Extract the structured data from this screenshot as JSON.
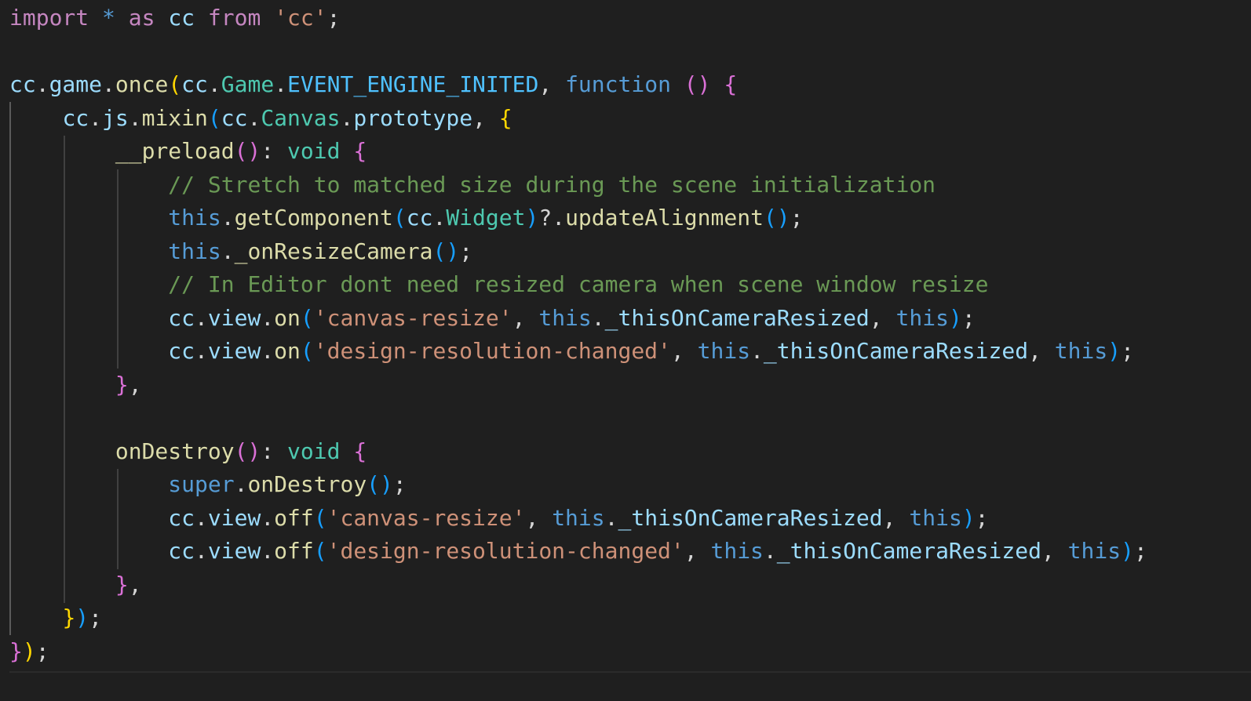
{
  "colors": {
    "background": "#1f1f1f",
    "keyword_control": "#c586c0",
    "keyword": "#569cd6",
    "variable": "#9cdcfe",
    "function": "#dcdcaa",
    "type": "#4ec9b0",
    "constant": "#4fc1ff",
    "string": "#ce9178",
    "comment": "#6a9955",
    "bracket_1": "#ffd700",
    "bracket_2": "#da70d6",
    "bracket_3": "#179fff"
  },
  "lines": [
    [
      [
        "kw-purple",
        "import"
      ],
      [
        "pun",
        " "
      ],
      [
        "kw-blue",
        "*"
      ],
      [
        "pun",
        " "
      ],
      [
        "kw-purple",
        "as"
      ],
      [
        "pun",
        " "
      ],
      [
        "var",
        "cc"
      ],
      [
        "pun",
        " "
      ],
      [
        "kw-purple",
        "from"
      ],
      [
        "pun",
        " "
      ],
      [
        "str",
        "'cc'"
      ],
      [
        "pun",
        ";"
      ]
    ],
    [],
    [
      [
        "var",
        "cc"
      ],
      [
        "pun",
        "."
      ],
      [
        "var",
        "game"
      ],
      [
        "pun",
        "."
      ],
      [
        "fn",
        "once"
      ],
      [
        "b1",
        "("
      ],
      [
        "var",
        "cc"
      ],
      [
        "pun",
        "."
      ],
      [
        "cls",
        "Game"
      ],
      [
        "pun",
        "."
      ],
      [
        "cst",
        "EVENT_ENGINE_INITED"
      ],
      [
        "pun",
        ", "
      ],
      [
        "kw-blue",
        "function"
      ],
      [
        "pun",
        " "
      ],
      [
        "b2",
        "()"
      ],
      [
        "pun",
        " "
      ],
      [
        "b2",
        "{"
      ]
    ],
    [
      [
        "pun",
        "    "
      ],
      [
        "var",
        "cc"
      ],
      [
        "pun",
        "."
      ],
      [
        "var",
        "js"
      ],
      [
        "pun",
        "."
      ],
      [
        "fn",
        "mixin"
      ],
      [
        "b3",
        "("
      ],
      [
        "var",
        "cc"
      ],
      [
        "pun",
        "."
      ],
      [
        "cls",
        "Canvas"
      ],
      [
        "pun",
        "."
      ],
      [
        "var",
        "prototype"
      ],
      [
        "pun",
        ", "
      ],
      [
        "b1",
        "{"
      ]
    ],
    [
      [
        "pun",
        "        "
      ],
      [
        "fn",
        "__preload"
      ],
      [
        "b2",
        "()"
      ],
      [
        "pun",
        ": "
      ],
      [
        "cls",
        "void"
      ],
      [
        "pun",
        " "
      ],
      [
        "b2",
        "{"
      ]
    ],
    [
      [
        "pun",
        "            "
      ],
      [
        "cmt",
        "// Stretch to matched size during the scene initialization"
      ]
    ],
    [
      [
        "pun",
        "            "
      ],
      [
        "kw-blue",
        "this"
      ],
      [
        "pun",
        "."
      ],
      [
        "fn",
        "getComponent"
      ],
      [
        "b3",
        "("
      ],
      [
        "var",
        "cc"
      ],
      [
        "pun",
        "."
      ],
      [
        "cls",
        "Widget"
      ],
      [
        "b3",
        ")"
      ],
      [
        "pun",
        "?."
      ],
      [
        "fn",
        "updateAlignment"
      ],
      [
        "b3",
        "()"
      ],
      [
        "pun",
        ";"
      ]
    ],
    [
      [
        "pun",
        "            "
      ],
      [
        "kw-blue",
        "this"
      ],
      [
        "pun",
        "."
      ],
      [
        "fn",
        "_onResizeCamera"
      ],
      [
        "b3",
        "()"
      ],
      [
        "pun",
        ";"
      ]
    ],
    [
      [
        "pun",
        "            "
      ],
      [
        "cmt",
        "// In Editor dont need resized camera when scene window resize"
      ]
    ],
    [
      [
        "pun",
        "            "
      ],
      [
        "var",
        "cc"
      ],
      [
        "pun",
        "."
      ],
      [
        "var",
        "view"
      ],
      [
        "pun",
        "."
      ],
      [
        "fn",
        "on"
      ],
      [
        "b3",
        "("
      ],
      [
        "str",
        "'canvas-resize'"
      ],
      [
        "pun",
        ", "
      ],
      [
        "kw-blue",
        "this"
      ],
      [
        "pun",
        "."
      ],
      [
        "var",
        "_thisOnCameraResized"
      ],
      [
        "pun",
        ", "
      ],
      [
        "kw-blue",
        "this"
      ],
      [
        "b3",
        ")"
      ],
      [
        "pun",
        ";"
      ]
    ],
    [
      [
        "pun",
        "            "
      ],
      [
        "var",
        "cc"
      ],
      [
        "pun",
        "."
      ],
      [
        "var",
        "view"
      ],
      [
        "pun",
        "."
      ],
      [
        "fn",
        "on"
      ],
      [
        "b3",
        "("
      ],
      [
        "str",
        "'design-resolution-changed'"
      ],
      [
        "pun",
        ", "
      ],
      [
        "kw-blue",
        "this"
      ],
      [
        "pun",
        "."
      ],
      [
        "var",
        "_thisOnCameraResized"
      ],
      [
        "pun",
        ", "
      ],
      [
        "kw-blue",
        "this"
      ],
      [
        "b3",
        ")"
      ],
      [
        "pun",
        ";"
      ]
    ],
    [
      [
        "pun",
        "        "
      ],
      [
        "b2",
        "}"
      ],
      [
        "pun",
        ","
      ]
    ],
    [],
    [
      [
        "pun",
        "        "
      ],
      [
        "fn",
        "onDestroy"
      ],
      [
        "b2",
        "()"
      ],
      [
        "pun",
        ": "
      ],
      [
        "cls",
        "void"
      ],
      [
        "pun",
        " "
      ],
      [
        "b2",
        "{"
      ]
    ],
    [
      [
        "pun",
        "            "
      ],
      [
        "kw-blue",
        "super"
      ],
      [
        "pun",
        "."
      ],
      [
        "fn",
        "onDestroy"
      ],
      [
        "b3",
        "()"
      ],
      [
        "pun",
        ";"
      ]
    ],
    [
      [
        "pun",
        "            "
      ],
      [
        "var",
        "cc"
      ],
      [
        "pun",
        "."
      ],
      [
        "var",
        "view"
      ],
      [
        "pun",
        "."
      ],
      [
        "fn",
        "off"
      ],
      [
        "b3",
        "("
      ],
      [
        "str",
        "'canvas-resize'"
      ],
      [
        "pun",
        ", "
      ],
      [
        "kw-blue",
        "this"
      ],
      [
        "pun",
        "."
      ],
      [
        "var",
        "_thisOnCameraResized"
      ],
      [
        "pun",
        ", "
      ],
      [
        "kw-blue",
        "this"
      ],
      [
        "b3",
        ")"
      ],
      [
        "pun",
        ";"
      ]
    ],
    [
      [
        "pun",
        "            "
      ],
      [
        "var",
        "cc"
      ],
      [
        "pun",
        "."
      ],
      [
        "var",
        "view"
      ],
      [
        "pun",
        "."
      ],
      [
        "fn",
        "off"
      ],
      [
        "b3",
        "("
      ],
      [
        "str",
        "'design-resolution-changed'"
      ],
      [
        "pun",
        ", "
      ],
      [
        "kw-blue",
        "this"
      ],
      [
        "pun",
        "."
      ],
      [
        "var",
        "_thisOnCameraResized"
      ],
      [
        "pun",
        ", "
      ],
      [
        "kw-blue",
        "this"
      ],
      [
        "b3",
        ")"
      ],
      [
        "pun",
        ";"
      ]
    ],
    [
      [
        "pun",
        "        "
      ],
      [
        "b2",
        "}"
      ],
      [
        "pun",
        ","
      ]
    ],
    [
      [
        "pun",
        "    "
      ],
      [
        "b1",
        "}"
      ],
      [
        "b3",
        ")"
      ],
      [
        "pun",
        ";"
      ]
    ],
    [
      [
        "b2",
        "}"
      ],
      [
        "b1",
        ")"
      ],
      [
        "pun",
        ";"
      ]
    ]
  ]
}
